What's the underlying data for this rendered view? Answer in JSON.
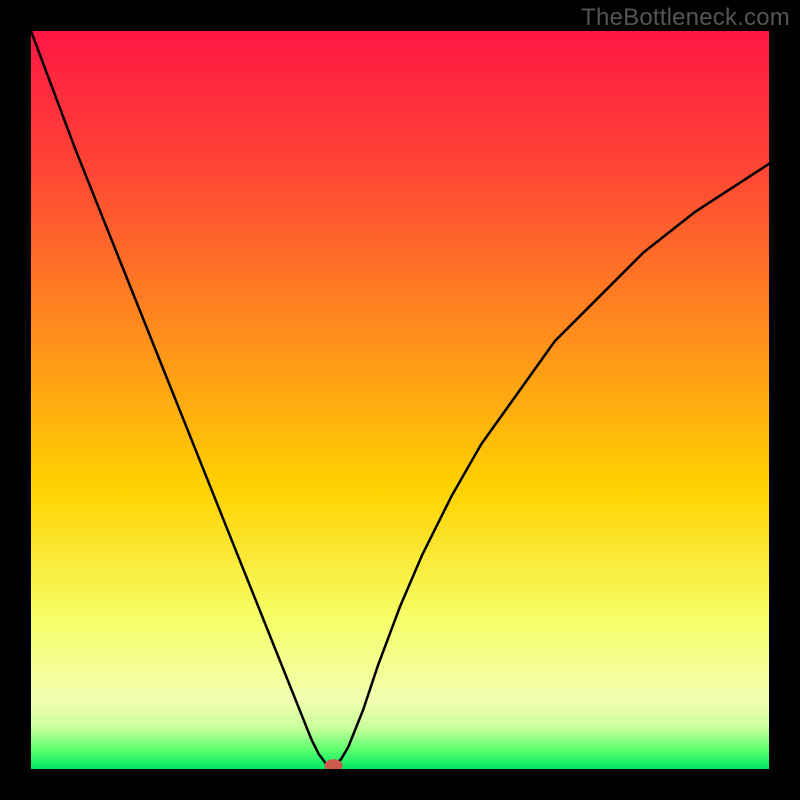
{
  "watermark": "TheBottleneck.com",
  "chart_data": {
    "type": "line",
    "title": "",
    "xlabel": "",
    "ylabel": "",
    "xlim": [
      0,
      100
    ],
    "ylim": [
      0,
      100
    ],
    "grid": false,
    "legend": false,
    "background": {
      "type": "vertical-gradient",
      "description": "Red at top through orange and yellow to green at bottom; indicates bottleneck severity (low/green = good, high/red = bad)",
      "stops": [
        {
          "pos": 0.0,
          "color": "#ff1744"
        },
        {
          "pos": 0.18,
          "color": "#ff4336"
        },
        {
          "pos": 0.4,
          "color": "#ff8a1e"
        },
        {
          "pos": 0.62,
          "color": "#ffd200"
        },
        {
          "pos": 0.8,
          "color": "#f6ff6a"
        },
        {
          "pos": 0.905,
          "color": "#f2ffb0"
        },
        {
          "pos": 0.945,
          "color": "#c8ff9b"
        },
        {
          "pos": 0.975,
          "color": "#56ff6e"
        },
        {
          "pos": 1.0,
          "color": "#00e861"
        }
      ]
    },
    "series": [
      {
        "name": "bottleneck-curve",
        "color": "#000000",
        "stroke_width": 2.5,
        "x": [
          0,
          3,
          6,
          9,
          12,
          15,
          18,
          21,
          24,
          27,
          30,
          33,
          36,
          38,
          39,
          40,
          41,
          42,
          43,
          45,
          47,
          50,
          53,
          57,
          61,
          66,
          71,
          77,
          83,
          90,
          100
        ],
        "y": [
          100,
          92,
          84,
          76.5,
          69,
          61.5,
          54,
          46.5,
          39,
          31.5,
          24,
          16.5,
          9,
          4,
          2,
          0.7,
          0.5,
          1.3,
          3,
          8,
          14,
          22,
          29,
          37,
          44,
          51,
          58,
          64,
          70,
          75.5,
          82
        ]
      }
    ],
    "marker": {
      "name": "optimal-point",
      "x": 41,
      "y": 0.5,
      "color": "#cc5a4a",
      "rx": 9,
      "ry": 6
    }
  }
}
